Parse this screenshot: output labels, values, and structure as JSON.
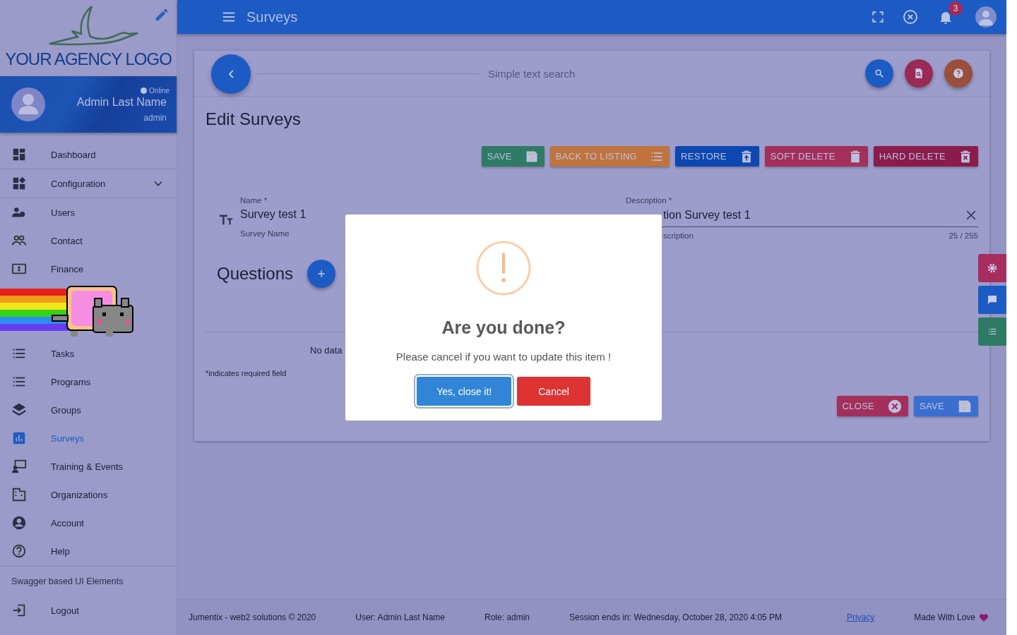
{
  "header": {
    "title": "Surveys",
    "notifications": "3"
  },
  "sidebar": {
    "logo": "YOUR AGENCY LOGO",
    "profile": {
      "status": "Online",
      "name": "Admin Last Name",
      "role": "admin"
    },
    "items": [
      {
        "label": "Dashboard",
        "kind": "link",
        "selected": false
      },
      {
        "label": "Configuration",
        "kind": "group",
        "selected": false
      },
      {
        "label": "Users",
        "kind": "link",
        "selected": false
      },
      {
        "label": "Contact",
        "kind": "link",
        "selected": false
      },
      {
        "label": "Finance",
        "kind": "link",
        "selected": false
      }
    ],
    "items_below": [
      {
        "label": "Tasks",
        "selected": false
      },
      {
        "label": "Programs",
        "selected": false
      },
      {
        "label": "Groups",
        "selected": false
      },
      {
        "label": "Surveys",
        "selected": true
      },
      {
        "label": "Training & Events",
        "selected": false
      },
      {
        "label": "Organizations",
        "selected": false
      },
      {
        "label": "Account",
        "selected": false
      },
      {
        "label": "Help",
        "selected": false
      }
    ],
    "section": "Swagger based UI Elements",
    "logout": "Logout"
  },
  "card": {
    "search_placeholder": "Simple text search",
    "title": "Edit Surveys",
    "actions": [
      {
        "label": "SAVE",
        "color": "#2f7a64"
      },
      {
        "label": "BACK TO LISTING",
        "color": "#c0733c"
      },
      {
        "label": "RESTORE",
        "color": "#0d48b0"
      },
      {
        "label": "SOFT DELETE",
        "color": "#a3305a"
      },
      {
        "label": "HARD DELETE",
        "color": "#8a1c4c"
      }
    ],
    "name_field": {
      "label": "Name *",
      "value": "Survey test 1",
      "hint": "Survey Name"
    },
    "description_field": {
      "label": "Description *",
      "value": "tion Survey test 1",
      "hint": "scription",
      "counter": "25 / 255"
    },
    "questions": {
      "title": "Questions",
      "empty": "No data"
    },
    "required_note": "*indicates required field",
    "bottom_buttons": [
      {
        "label": "CLOSE",
        "color": "#a3305a"
      },
      {
        "label": "SAVE",
        "color": "#3a6fd0"
      }
    ]
  },
  "dialog": {
    "title": "Are you done?",
    "text": "Please cancel if you want to update this item !",
    "confirm": "Yes, close it!",
    "cancel": "Cancel"
  },
  "footer": {
    "copyright": "Jumentix - web2 solutions © 2020",
    "user": "User: Admin Last Name",
    "role": "Role: admin",
    "session": "Session ends in: Wednesday, October 28, 2020 4:05 PM",
    "privacy": "Privacy",
    "love": "Made With Love"
  }
}
